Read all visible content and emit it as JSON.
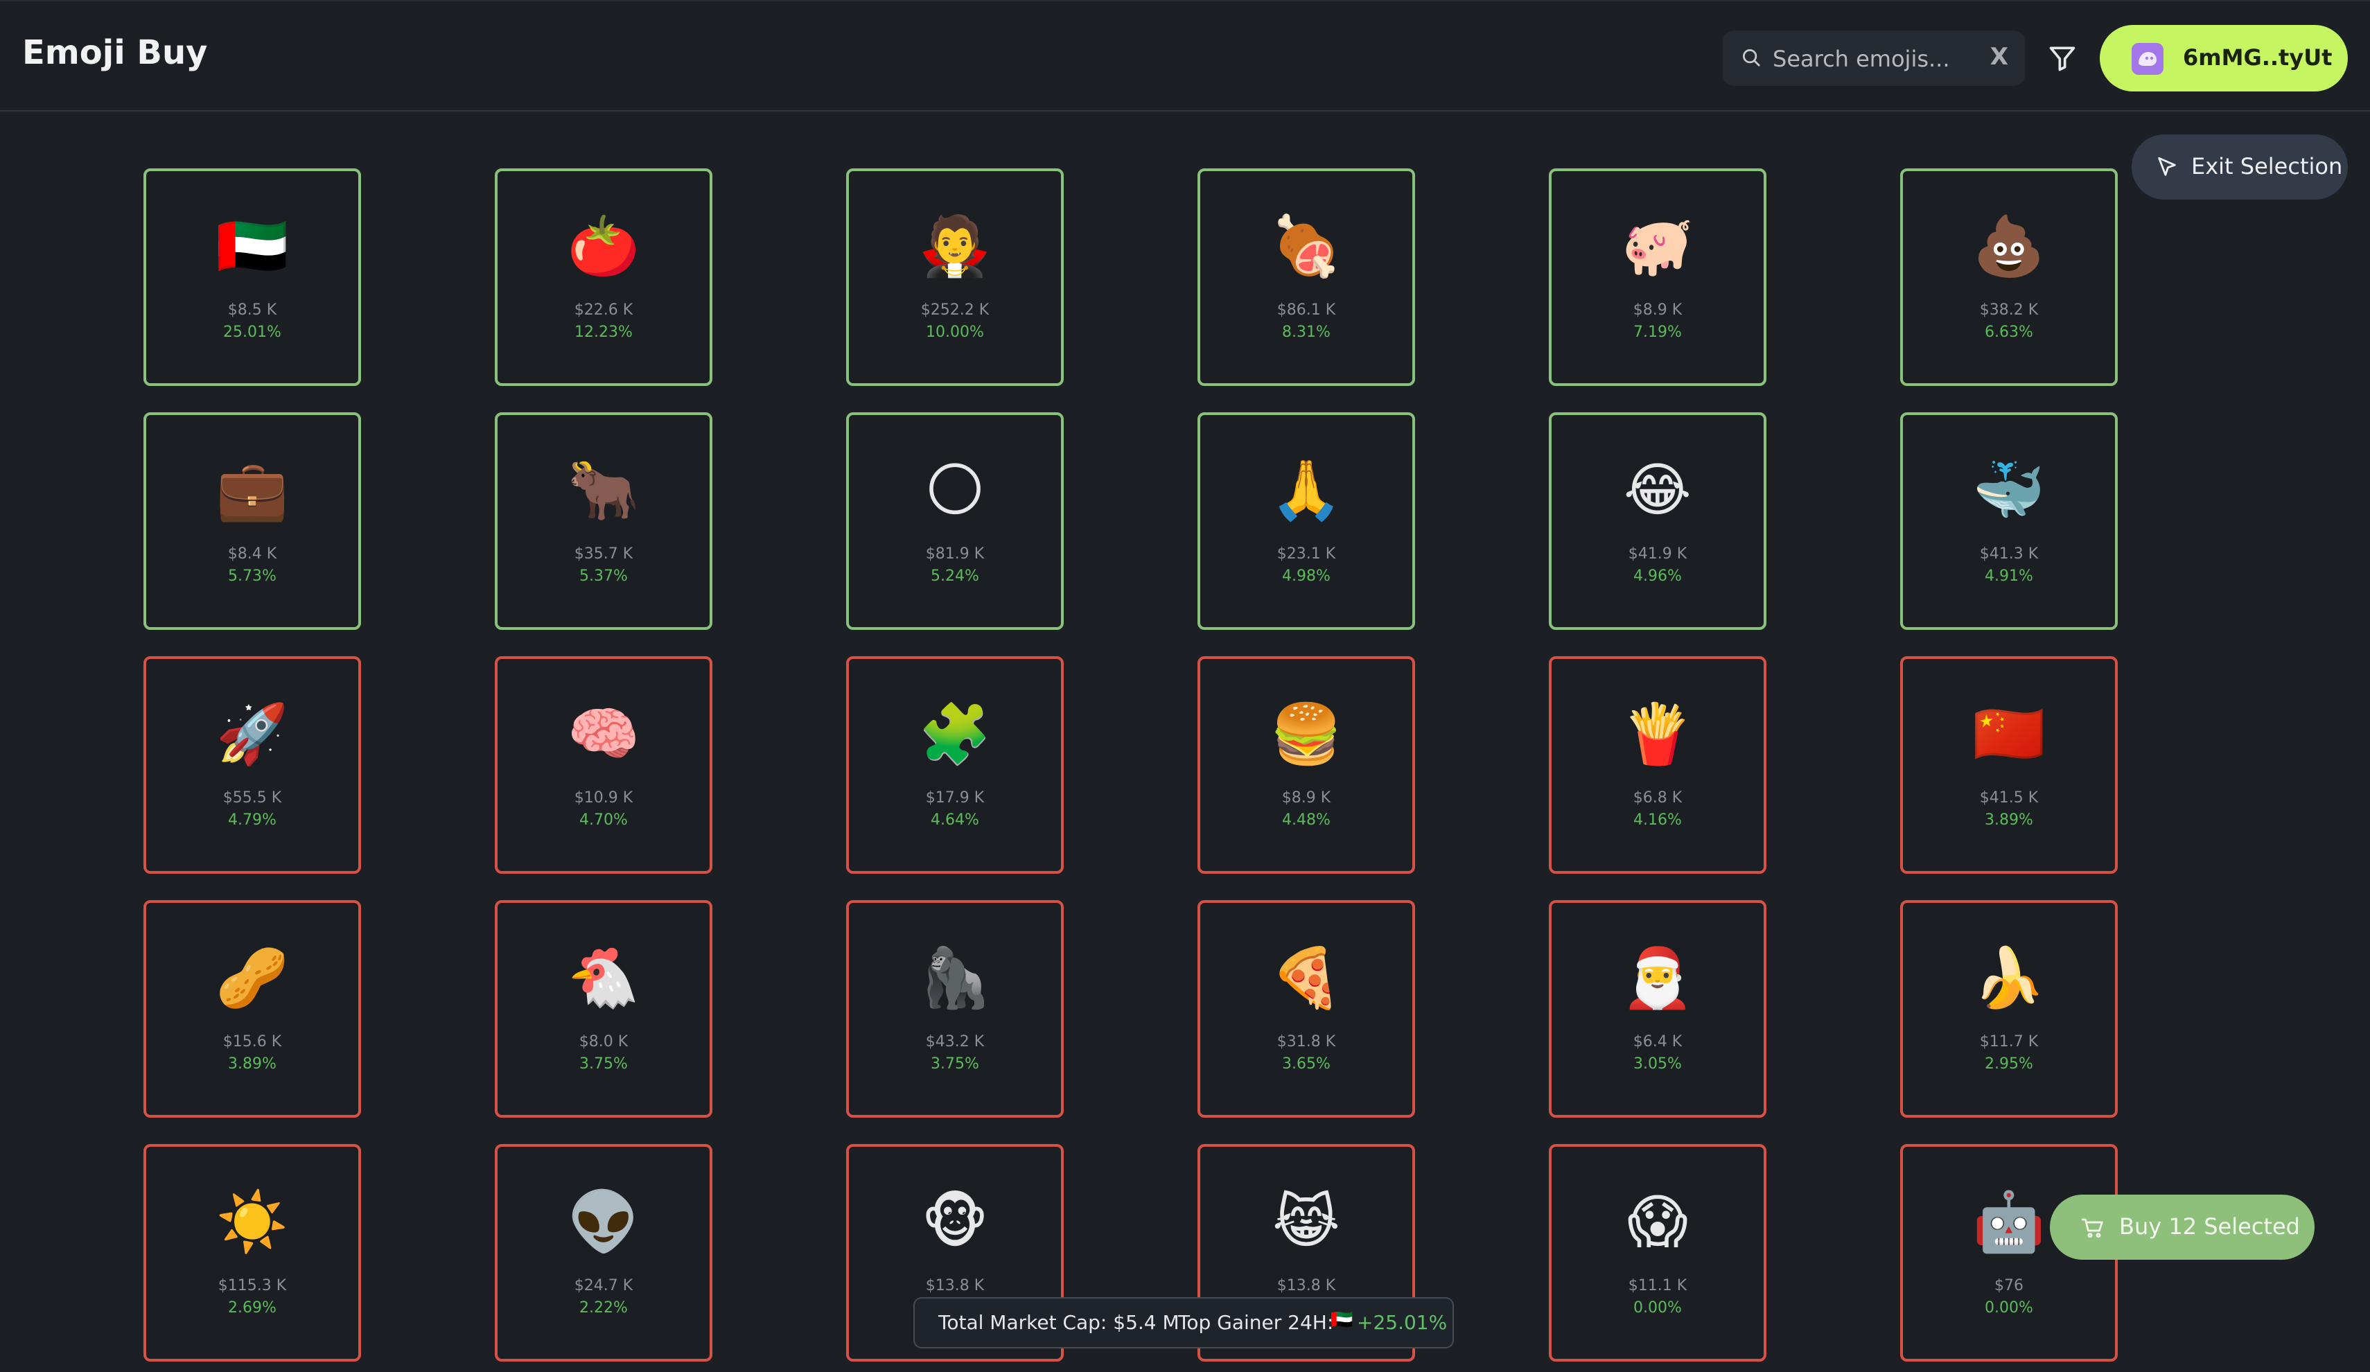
{
  "header": {
    "title": "Emoji Buy",
    "search_placeholder": "Search emojis...",
    "search_value": "",
    "clear_label": "X",
    "wallet_label": "6mMG..tyUt"
  },
  "exit_selection_label": "Exit Selection",
  "buy_selected_label": "Buy 12 Selected",
  "colors": {
    "up_border": "#89c27a",
    "down_border": "#d65146",
    "wallet_bg": "#c5f560",
    "buy_bg": "#8ec07c",
    "change_text": "#5cbb5a"
  },
  "tiles": [
    {
      "emoji": "🇦🇪",
      "price": "$8.5 K",
      "change": "25.01%",
      "border": "up"
    },
    {
      "emoji": "🍅",
      "price": "$22.6 K",
      "change": "12.23%",
      "border": "up"
    },
    {
      "emoji": "🧛",
      "price": "$252.2 K",
      "change": "10.00%",
      "border": "up"
    },
    {
      "emoji": "🍖",
      "price": "$86.1 K",
      "change": "8.31%",
      "border": "up"
    },
    {
      "emoji": "🐖",
      "price": "$8.9 K",
      "change": "7.19%",
      "border": "up"
    },
    {
      "emoji": "💩",
      "price": "$38.2 K",
      "change": "6.63%",
      "border": "up"
    },
    {
      "emoji": "💼",
      "price": "$8.4 K",
      "change": "5.73%",
      "border": "up"
    },
    {
      "emoji": "🐂",
      "price": "$35.7 K",
      "change": "5.37%",
      "border": "up"
    },
    {
      "emoji": "🌕",
      "price": "$81.9 K",
      "change": "5.24%",
      "border": "up"
    },
    {
      "emoji": "🙏",
      "price": "$23.1 K",
      "change": "4.98%",
      "border": "up"
    },
    {
      "emoji": "😂",
      "price": "$41.9 K",
      "change": "4.96%",
      "border": "up"
    },
    {
      "emoji": "🐳",
      "price": "$41.3 K",
      "change": "4.91%",
      "border": "up"
    },
    {
      "emoji": "🚀",
      "price": "$55.5 K",
      "change": "4.79%",
      "border": "down"
    },
    {
      "emoji": "🧠",
      "price": "$10.9 K",
      "change": "4.70%",
      "border": "down"
    },
    {
      "emoji": "🧩",
      "price": "$17.9 K",
      "change": "4.64%",
      "border": "down"
    },
    {
      "emoji": "🍔",
      "price": "$8.9 K",
      "change": "4.48%",
      "border": "down"
    },
    {
      "emoji": "🍟",
      "price": "$6.8 K",
      "change": "4.16%",
      "border": "down"
    },
    {
      "emoji": "🇨🇳",
      "price": "$41.5 K",
      "change": "3.89%",
      "border": "down"
    },
    {
      "emoji": "🥜",
      "price": "$15.6 K",
      "change": "3.89%",
      "border": "down"
    },
    {
      "emoji": "🐔",
      "price": "$8.0 K",
      "change": "3.75%",
      "border": "down"
    },
    {
      "emoji": "🦍",
      "price": "$43.2 K",
      "change": "3.75%",
      "border": "down"
    },
    {
      "emoji": "🍕",
      "price": "$31.8 K",
      "change": "3.65%",
      "border": "down"
    },
    {
      "emoji": "🎅",
      "price": "$6.4 K",
      "change": "3.05%",
      "border": "down"
    },
    {
      "emoji": "🍌",
      "price": "$11.7 K",
      "change": "2.95%",
      "border": "down"
    },
    {
      "emoji": "☀️",
      "price": "$115.3 K",
      "change": "2.69%",
      "border": "down"
    },
    {
      "emoji": "👽",
      "price": "$24.7 K",
      "change": "2.22%",
      "border": "down"
    },
    {
      "emoji": "🐵",
      "price": "$13.8 K",
      "change": "",
      "border": "down"
    },
    {
      "emoji": "😹",
      "price": "$13.8 K",
      "change": "",
      "border": "down"
    },
    {
      "emoji": "😱",
      "price": "$11.1 K",
      "change": "0.00%",
      "border": "down"
    },
    {
      "emoji": "🤖",
      "price": "$76",
      "change": "0.00%",
      "border": "down"
    }
  ],
  "footer": {
    "market_cap": "Total Market Cap: $5.4 M",
    "top_gainer_label": "Top Gainer 24H:",
    "top_gainer_flag": "🇦🇪",
    "top_gainer_change": "+25.01%"
  }
}
